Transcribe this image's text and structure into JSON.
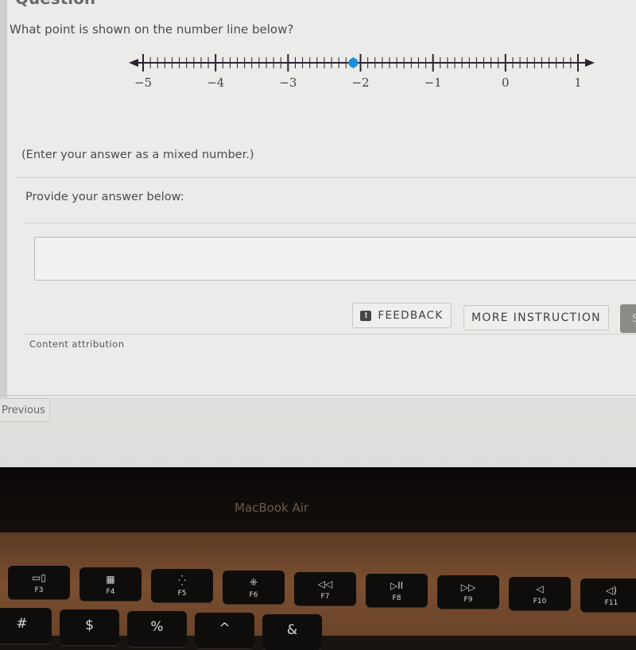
{
  "question": {
    "heading": "Question",
    "text": "What point is shown on the number line below?",
    "hint": "(Enter your answer as a mixed number.)",
    "prompt": "Provide your answer below:"
  },
  "answer": {
    "value": "",
    "placeholder": ""
  },
  "buttons": {
    "feedback": "FEEDBACK",
    "more_instruction": "MORE INSTRUCTION",
    "submit": "S",
    "previous": "Previous"
  },
  "attribution": "Content attribution",
  "number_line": {
    "min": -5,
    "max": 1,
    "subdivisions_per_unit": 10,
    "tick_labels": [
      "−5",
      "−4",
      "−3",
      "−2",
      "−1",
      "0",
      "1"
    ],
    "point_value": -2.1,
    "point_color": "#1a8fd8",
    "line_color": "#2b2230"
  },
  "device": {
    "brand": "MacBook Air",
    "function_keys": [
      {
        "glyph": "▭▯",
        "label": "F3"
      },
      {
        "glyph": "▦",
        "label": "F4"
      },
      {
        "glyph": "⁛",
        "label": "F5"
      },
      {
        "glyph": "⁜",
        "label": "F6"
      },
      {
        "glyph": "◁◁",
        "label": "F7"
      },
      {
        "glyph": "▷II",
        "label": "F8"
      },
      {
        "glyph": "▷▷",
        "label": "F9"
      },
      {
        "glyph": "◁",
        "label": "F10"
      },
      {
        "glyph": "◁)",
        "label": "F11"
      }
    ],
    "number_keys": [
      "#",
      "$",
      "%",
      "^",
      "&"
    ]
  }
}
